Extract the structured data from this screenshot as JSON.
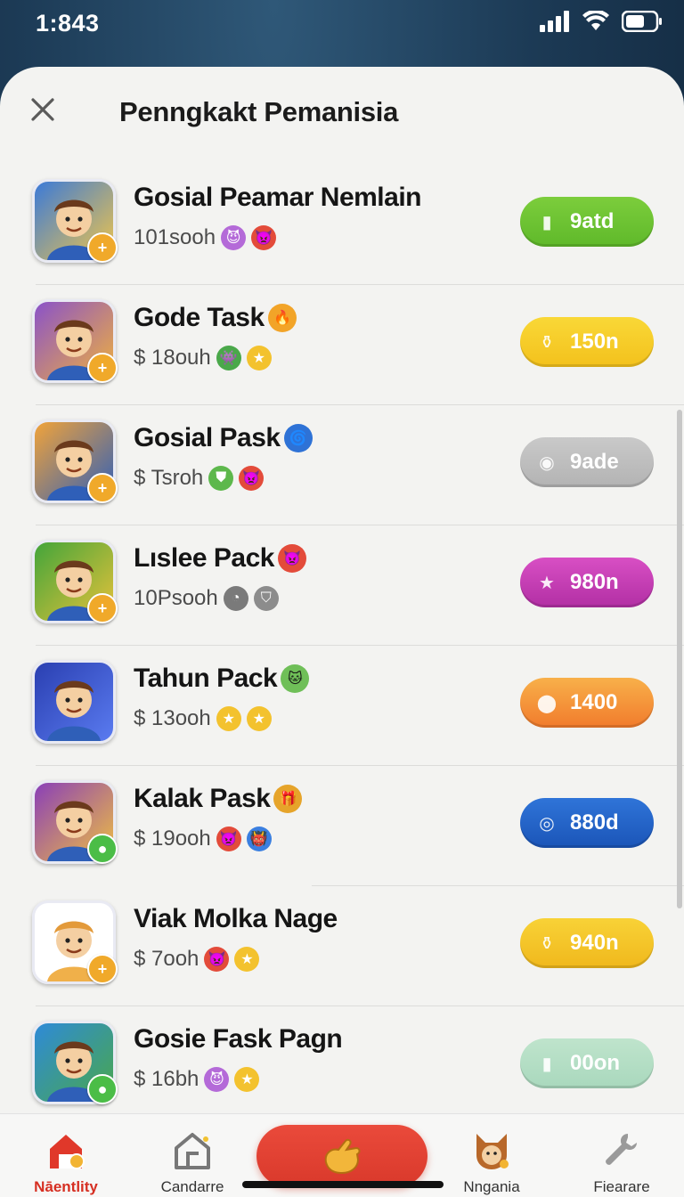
{
  "status_bar": {
    "time": "1:843"
  },
  "sheet": {
    "title": "Penngkakt Pemanisia"
  },
  "items": [
    {
      "title": "Gosial Peamar Nemlain",
      "title_emoji": "",
      "subtitle": "101sooh",
      "price": "9atd",
      "pill_color": "#7ccd3c",
      "pill_color2": "#5fb92a",
      "pill_glyph": "can-icon",
      "icon_bg": "#3b7ad8",
      "icon_bg2": "#f2c649",
      "badge": "+",
      "badge_color": "#f0a92a",
      "chips": [
        "purple-devil-icon",
        "red-devil-icon"
      ]
    },
    {
      "title": "Gode Task",
      "title_emoji": "fire-badge-icon",
      "subtitle": "$ 18ouh",
      "price": "150n",
      "pill_color": "#f9d837",
      "pill_color2": "#f3c11c",
      "pill_glyph": "coin-stack-icon",
      "icon_bg": "#8a52c9",
      "icon_bg2": "#f0b13d",
      "badge": "+",
      "badge_color": "#f0a92a",
      "chips": [
        "green-alien-icon",
        "star-icon"
      ]
    },
    {
      "title": "Gosial Pask",
      "title_emoji": "blue-swirl-icon",
      "subtitle": "$ Tsroh",
      "price": "9ade",
      "pill_color": "#c9c9c9",
      "pill_color2": "#b3b3b3",
      "pill_glyph": "medal-icon",
      "icon_bg": "#f1a33a",
      "icon_bg2": "#2f5fb8",
      "badge": "+",
      "badge_color": "#f0a92a",
      "chips": [
        "shield-icon",
        "red-devil-icon"
      ]
    },
    {
      "title": "Lıslee Pack",
      "title_emoji": "red-devil-icon",
      "subtitle": "10Psooh",
      "price": "980n",
      "pill_color": "#d84fc4",
      "pill_color2": "#b22fa4",
      "pill_glyph": "star-burst-icon",
      "icon_bg": "#43a53a",
      "icon_bg2": "#e8c23a",
      "badge": "+",
      "badge_color": "#f0a92a",
      "chips": [
        "timer-icon",
        "shield-gray-icon"
      ]
    },
    {
      "title": "Tahun Pack",
      "title_emoji": "green-cat-icon",
      "subtitle": "$ 13ooh",
      "price": "1400",
      "pill_color": "#f8b04a",
      "pill_color2": "#f17b2c",
      "pill_glyph": "purple-coin-icon",
      "icon_bg": "#2a3fb1",
      "icon_bg2": "#5a7bf0",
      "badge": "",
      "badge_color": "",
      "chips": [
        "star-icon",
        "star-icon"
      ]
    },
    {
      "title": "Kalak Pask",
      "title_emoji": "treasure-icon",
      "subtitle": "$ 19ooh",
      "price": "880d",
      "pill_color": "#2f74d8",
      "pill_color2": "#1b55b8",
      "pill_glyph": "ring-icon",
      "icon_bg": "#8a3fb8",
      "icon_bg2": "#f0c040",
      "badge": "●",
      "badge_color": "#4bbd47",
      "chips": [
        "red-devil-icon",
        "blue-monster-icon"
      ]
    },
    {
      "title": "Viak Molka Nage",
      "title_emoji": "",
      "subtitle": "$ 7ooh",
      "price": "940n",
      "pill_color": "#f8d237",
      "pill_color2": "#f0b81c",
      "pill_glyph": "coin-stack-icon",
      "icon_bg": "#ffffff",
      "icon_bg2": "#ffffff",
      "badge": "+",
      "badge_color": "#f0a92a",
      "chips": [
        "red-devil-icon",
        "star-icon"
      ]
    },
    {
      "title": "Gosie Fask Pagn",
      "title_emoji": "",
      "subtitle": "$ 16bh",
      "price": "00on",
      "pill_color": "#bfe4cc",
      "pill_color2": "#a9d8bd",
      "pill_glyph": "blue-can-icon",
      "icon_bg": "#2e8ad8",
      "icon_bg2": "#4aa84a",
      "badge": "●",
      "badge_color": "#4bbd47",
      "chips": [
        "purple-devil-icon",
        "star-icon"
      ]
    }
  ],
  "tabs": [
    {
      "label": "Nāentlity",
      "icon": "home-badge-icon",
      "active": true
    },
    {
      "label": "Candarre",
      "icon": "store-icon",
      "active": false
    },
    {
      "label": "",
      "icon": "hand-icon",
      "active": false
    },
    {
      "label": "Nngania",
      "icon": "fox-avatar-icon",
      "active": false
    },
    {
      "label": "Fiearare",
      "icon": "wrench-icon",
      "active": false
    }
  ]
}
